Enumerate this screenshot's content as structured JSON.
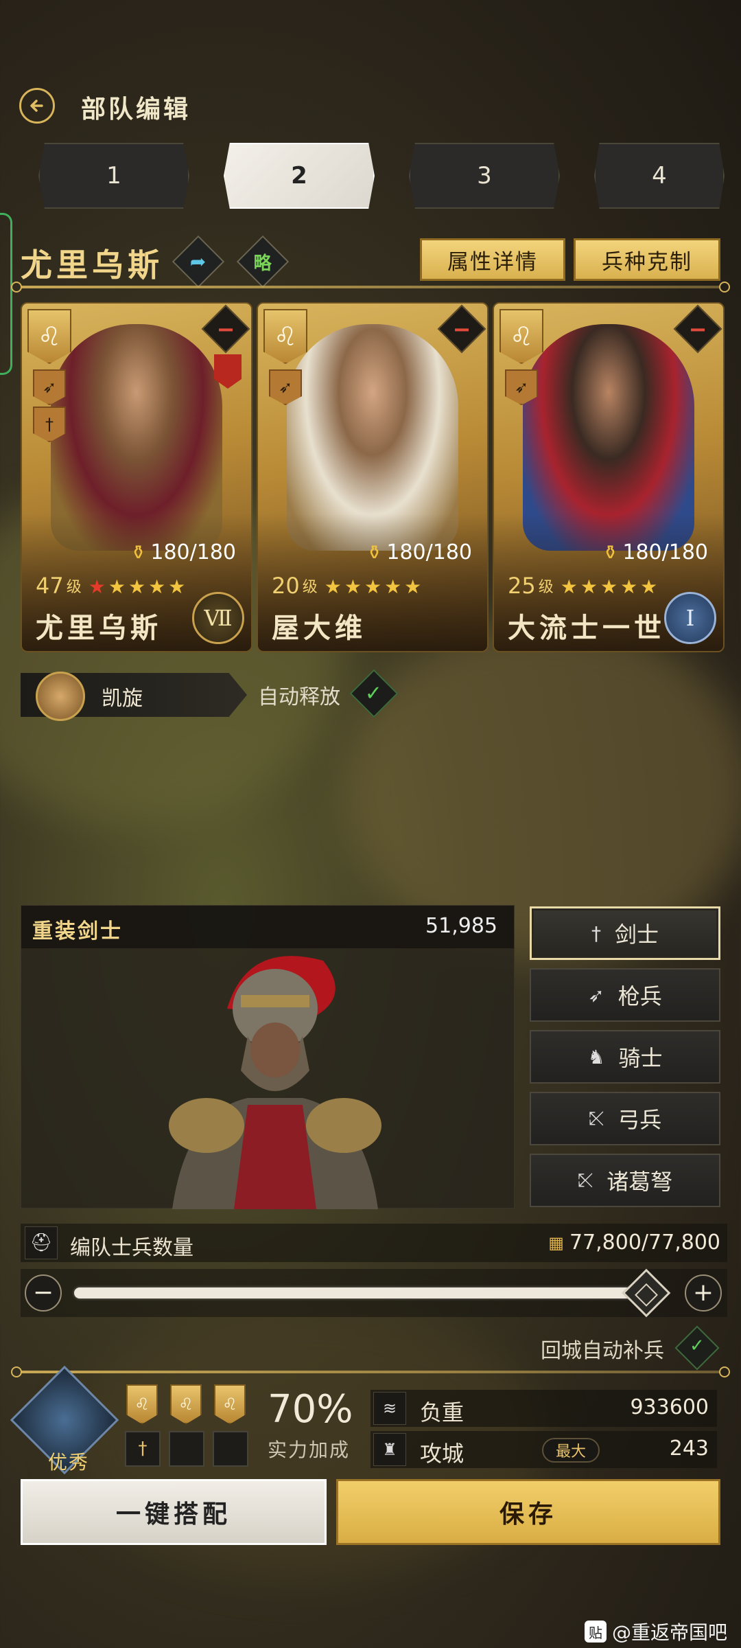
{
  "header": {
    "title": "部队编辑"
  },
  "tabs": [
    {
      "label": "1",
      "active": false
    },
    {
      "label": "2",
      "active": true
    },
    {
      "label": "3",
      "active": false
    },
    {
      "label": "4",
      "active": false
    }
  ],
  "team": {
    "name": "尤里乌斯",
    "strategy_label": "略",
    "attr_button": "属性详情",
    "counter_button": "兵种克制"
  },
  "heroes": [
    {
      "name": "尤里乌斯",
      "level": "47",
      "level_unit": "级",
      "stamina": "180/180",
      "rank": "Ⅶ",
      "stars": 5,
      "first_star_red": true
    },
    {
      "name": "屋大维",
      "level": "20",
      "level_unit": "级",
      "stamina": "180/180",
      "rank": "",
      "stars": 5,
      "first_star_red": false
    },
    {
      "name": "大流士一世",
      "level": "25",
      "level_unit": "级",
      "stamina": "180/180",
      "rank": "I",
      "stars": 5,
      "first_star_red": false
    }
  ],
  "skill": {
    "name": "凯旋",
    "auto_release_label": "自动释放",
    "auto_release_on": true
  },
  "troop": {
    "type": "重装剑士",
    "power": "51,985"
  },
  "unit_types": [
    {
      "label": "剑士",
      "icon": "sword-icon",
      "active": true
    },
    {
      "label": "枪兵",
      "icon": "spear-icon",
      "active": false
    },
    {
      "label": "骑士",
      "icon": "horse-icon",
      "active": false
    },
    {
      "label": "弓兵",
      "icon": "bow-icon",
      "active": false
    },
    {
      "label": "诸葛弩",
      "icon": "crossbow-icon",
      "active": false
    }
  ],
  "soldiers": {
    "label": "编队士兵数量",
    "count": "77,800/77,800",
    "slider_fraction": 1.0
  },
  "refill": {
    "label": "回城自动补兵",
    "enabled": true
  },
  "summary": {
    "grade": "优秀",
    "bonus_percent": "70%",
    "bonus_label": "实力加成",
    "load_label": "负重",
    "load_value": "933600",
    "siege_label": "攻城",
    "siege_tag": "最大",
    "siege_value": "243"
  },
  "actions": {
    "auto_match": "一键搭配",
    "save": "保存"
  },
  "watermark": "@重返帝国吧",
  "colors": {
    "gold": "#d8b55b",
    "green": "#5fcf5b",
    "red": "#e24a3b"
  }
}
